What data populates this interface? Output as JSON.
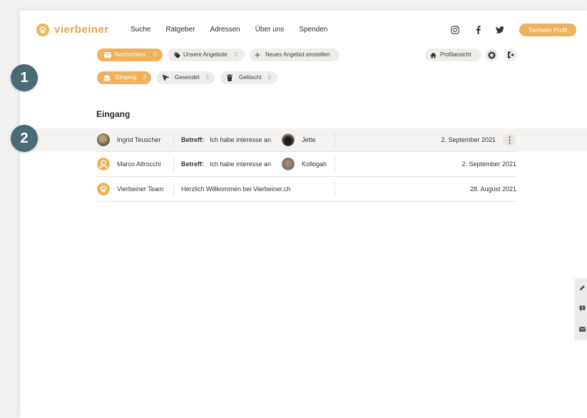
{
  "brand": {
    "name": "vierbeiner",
    "logo_icon": "paw-logo-icon"
  },
  "nav": {
    "items": [
      "Suche",
      "Ratgeber",
      "Adressen",
      "Über uns",
      "Spenden"
    ]
  },
  "header": {
    "social_icons": [
      "instagram-icon",
      "facebook-icon",
      "twitter-icon"
    ],
    "profile_button": "Tierheim Profil"
  },
  "toolbar": {
    "tabs": [
      {
        "label": "Nachrichten",
        "count": 3,
        "icon": "envelope-icon",
        "active": true
      },
      {
        "label": "Unsere Angebote",
        "count": 5,
        "icon": "tag-icon",
        "active": false
      },
      {
        "label": "Neues Angebot einstellen",
        "icon": "plus-icon",
        "active": false
      }
    ],
    "profile_view": {
      "label": "Profilansicht",
      "icon": "house-icon"
    },
    "settings_icon": "gear-icon",
    "logout_icon": "logout-icon"
  },
  "folders": [
    {
      "label": "Eingang",
      "count": 3,
      "icon": "inbox-icon",
      "active": true
    },
    {
      "label": "Gesendet",
      "count": 1,
      "icon": "paper-plane-icon",
      "active": false
    },
    {
      "label": "Gelöscht",
      "count": 0,
      "icon": "trash-icon",
      "active": false
    }
  ],
  "inbox": {
    "title": "Eingang",
    "messages": [
      {
        "sender": "Ingrid Teuscher",
        "subject_label": "Betreff:",
        "subject": "Ich habe interesse an",
        "pet": "Jette",
        "date": "2. September 2021",
        "highlighted": true,
        "menu_icon": "kebab-menu-icon"
      },
      {
        "sender": "Marco Altrocchi",
        "sender_icon": "person-icon",
        "subject_label": "Betreff:",
        "subject": "Ich habe interesse an",
        "pet": "Kollogah",
        "date": "2. September 2021",
        "highlighted": false
      },
      {
        "sender": "Vierbeiner Team",
        "sender_icon": "paw-icon",
        "subject": "Herzlich Willkommen bei Vierbeiner.ch",
        "date": "28. August 2021",
        "highlighted": false
      }
    ]
  },
  "side_tab": {
    "icons": [
      "pencil-icon",
      "comment-icon",
      "mail-icon"
    ]
  },
  "annotations": [
    {
      "label": "1"
    },
    {
      "label": "2"
    }
  ],
  "colors": {
    "brand": "#efb15b",
    "brand_text": "#e8a54b",
    "annotation": "#4a6a76",
    "pill": "#efedea",
    "row_highlight": "#f5f3f1"
  }
}
